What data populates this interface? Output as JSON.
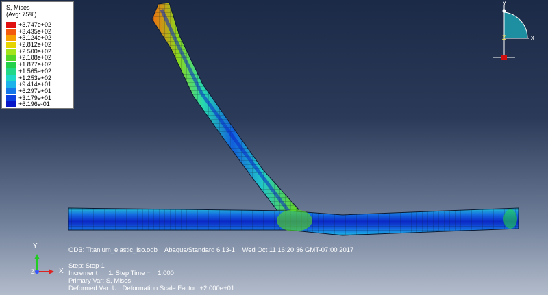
{
  "legend": {
    "title": "S, Mises",
    "subtitle": "(Avg: 75%)",
    "entries": [
      {
        "value": "+3.747e+02",
        "color": "#e01010"
      },
      {
        "value": "+3.435e+02",
        "color": "#f45a0c"
      },
      {
        "value": "+3.124e+02",
        "color": "#f8a000"
      },
      {
        "value": "+2.812e+02",
        "color": "#e6d400"
      },
      {
        "value": "+2.500e+02",
        "color": "#a4e41a"
      },
      {
        "value": "+2.188e+02",
        "color": "#54d626"
      },
      {
        "value": "+1.877e+02",
        "color": "#22d04a"
      },
      {
        "value": "+1.565e+02",
        "color": "#20d888"
      },
      {
        "value": "+1.253e+02",
        "color": "#1ed8c8"
      },
      {
        "value": "+9.414e+01",
        "color": "#1cb2ea"
      },
      {
        "value": "+6.297e+01",
        "color": "#1476e8"
      },
      {
        "value": "+3.179e+01",
        "color": "#0c40e0"
      },
      {
        "value": "+6.196e-01",
        "color": "#0818c8"
      }
    ]
  },
  "info": {
    "odb": "ODB: Titanium_elastic_iso.odb    Abaqus/Standard 6.13-1    Wed Oct 11 16:20:36 GMT-07:00 2017",
    "step": "Step: Step-1",
    "increment": "Increment      1: Step Time =    1.000",
    "primary": "Primary Var: S, Mises",
    "deformed": "Deformed Var: U   Deformation Scale Factor: +2.000e+01"
  },
  "triad": {
    "y": "Y",
    "x": "X",
    "z": "Z"
  },
  "orientation": {
    "y": "Y",
    "x": "X",
    "z": "Z"
  }
}
